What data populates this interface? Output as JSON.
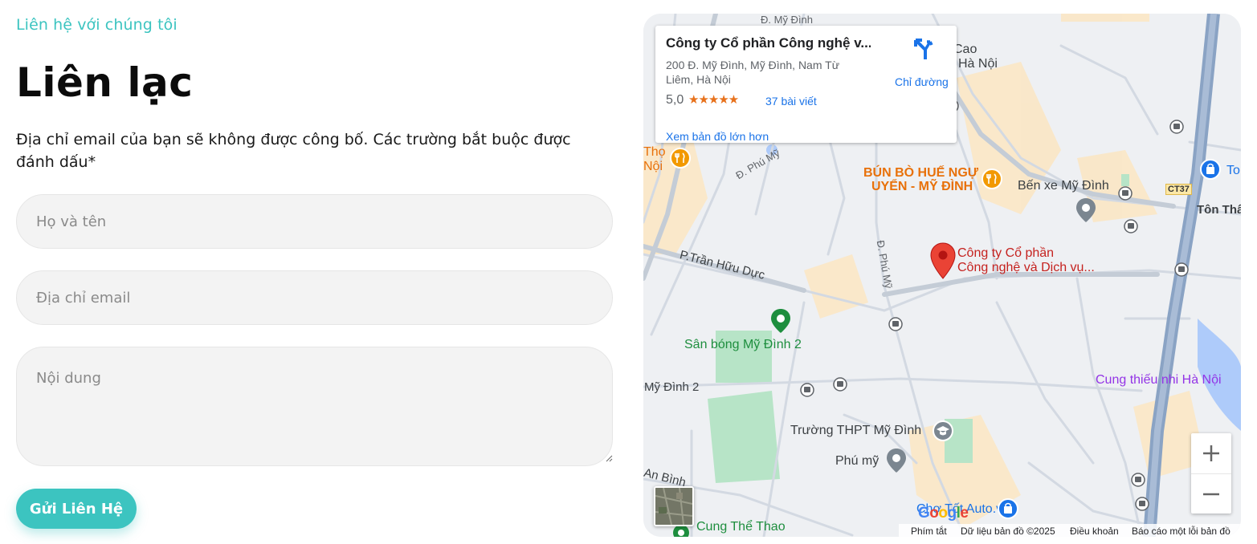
{
  "contact": {
    "eyebrow": "Liên hệ với chúng tôi",
    "title": "Liên lạc",
    "note": "Địa chỉ email của bạn sẽ không được công bố. Các trường bắt buộc được đánh dấu*",
    "fields": {
      "name_placeholder": "Họ và tên",
      "email_placeholder": "Địa chỉ email",
      "message_placeholder": "Nội dung"
    },
    "submit_label": "Gửi Liên Hệ",
    "accent_color": "#3cc4c0"
  },
  "map": {
    "card": {
      "title": "Công ty Cổ phần Công nghệ v...",
      "address": "200 Đ. Mỹ Đình, Mỹ Đình, Nam Từ Liêm, Hà Nội",
      "rating": "5,0",
      "stars": "★★★★★",
      "reviews": "37 bài viết",
      "bigger_map": "Xem bản đồ lớn hơn",
      "directions": "Chỉ đường"
    },
    "labels": {
      "street_20": "Đ. Mỹ Đình",
      "cao": "Cao",
      "ha_noi": "Hà Nội",
      "tho": "Thọ",
      "noi": "Nội",
      "phu_my_1": "Đ. Phú Mỹ",
      "phu_my_2": "Đ. Phú Mỹ",
      "bun_bo_1": "BÚN BÒ HUẾ NGỰ",
      "bun_bo_2": "UYỂN - MỸ ĐÌNH",
      "ben_xe": "Bến xe Mỹ Đình",
      "ct37": "CT37",
      "ton_that": "Tôn Thấ",
      "to": "To",
      "company_1": "Công ty Cổ phần",
      "company_2": "Công nghệ và Dịch vụ...",
      "tran_huu_duc": "P.Trần Hữu Dực",
      "san_bong": "Sân bóng Mỹ Đình 2",
      "my_dinh_2": "Mỹ Đình 2",
      "cung_thieu_nhi": "Cung thiếu nhi Hà Nội",
      "truong_thpt": "Trường THPT Mỹ Đình",
      "phu_my_area": "Phú mỹ",
      "an_binh": "An Bình",
      "cung_the_thao": "Cung Thể Thao",
      "cho_tot": "Chợ Tốt Auto.vn"
    },
    "google": [
      "G",
      "o",
      "o",
      "g",
      "l",
      "e"
    ],
    "google_colors": [
      "#4285f4",
      "#ea4335",
      "#fbbc05",
      "#4285f4",
      "#34a853",
      "#ea4335"
    ],
    "attribution": {
      "shortcuts": "Phím tắt",
      "map_data": "Dữ liệu bản đồ ©2025",
      "terms": "Điều khoản",
      "report": "Báo cáo một lỗi bản đồ"
    },
    "colors": {
      "water": "#8ab4f8",
      "highway": "#8aa3c4",
      "park": "#b7e4c7",
      "building": "#fbe6c2",
      "pin": "#ea4335"
    }
  }
}
